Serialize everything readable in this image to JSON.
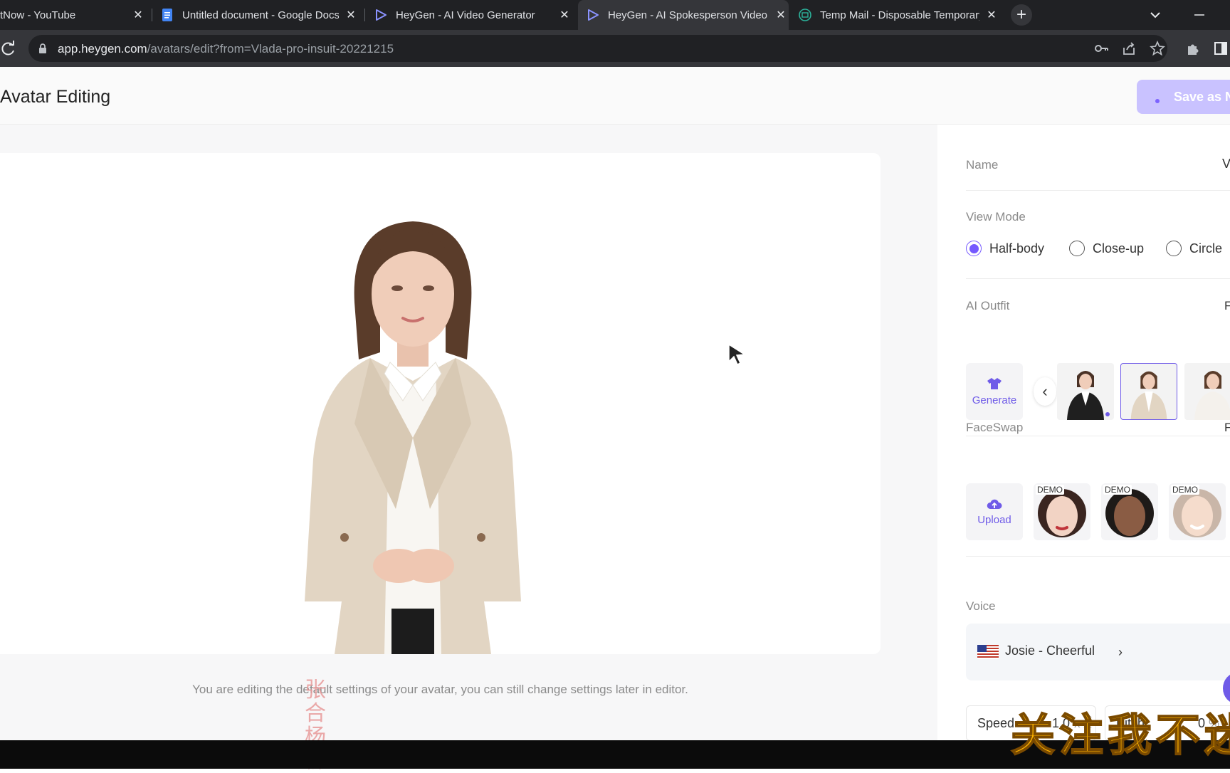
{
  "browser": {
    "tabs": [
      {
        "title": "tNow - YouTube",
        "icon": "youtube-icon"
      },
      {
        "title": "Untitled document - Google Docs",
        "icon": "google-docs-icon"
      },
      {
        "title": "HeyGen - AI Video Generator",
        "icon": "heygen-icon"
      },
      {
        "title": "HeyGen - AI Spokesperson Video",
        "icon": "heygen-icon"
      },
      {
        "title": "Temp Mail - Disposable Temporary",
        "icon": "tempmail-icon"
      }
    ],
    "new_tab": "+",
    "url_host": "app.heygen.com",
    "url_path": "/avatars/edit?from=Vlada-pro-insuit-20221215"
  },
  "header": {
    "title": "Avatar Editing",
    "save_label": "Save as N"
  },
  "preview": {
    "hint": "You are editing the default settings of your avatar, you can still change settings later in editor.",
    "seal_text": "张合杨柳"
  },
  "panel": {
    "name_label": "Name",
    "name_value": "V",
    "view_mode_label": "View Mode",
    "view_modes": [
      {
        "label": "Half-body",
        "selected": true
      },
      {
        "label": "Close-up",
        "selected": false
      },
      {
        "label": "Circle",
        "selected": false
      }
    ],
    "ai_outfit_label": "AI Outfit",
    "ai_outfit_right": "F",
    "generate_label": "Generate",
    "faceswap_label": "FaceSwap",
    "faceswap_right": "F",
    "upload_label": "Upload",
    "demo_label": "DEMO",
    "voice_label": "Voice",
    "voice_name": "Josie - Cheerful",
    "speed_label": "Speed",
    "speed_value": "1.0",
    "speed_unit": "x",
    "pitch_label": "Pitch",
    "pitch_value": "0",
    "pitch_unit": "%"
  },
  "overlay_text": "关注我不迷",
  "colors": {
    "accent": "#7559ff",
    "save_button": "#c9c2ff",
    "chrome_dark": "#202124",
    "chrome_toolbar": "#35363a"
  }
}
